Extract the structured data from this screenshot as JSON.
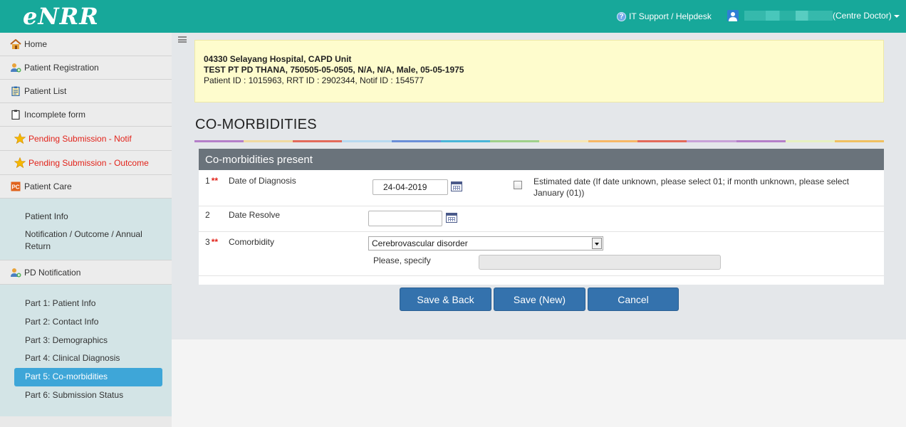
{
  "app": {
    "logo": "eNRR"
  },
  "header": {
    "helpdesk_label": "IT Support / Helpdesk",
    "user_role": "(Centre Doctor)"
  },
  "sidebar": {
    "items": [
      {
        "label": "Home",
        "icon": "home-icon"
      },
      {
        "label": "Patient Registration",
        "icon": "user-add-icon"
      },
      {
        "label": "Patient List",
        "icon": "clipboard-icon"
      },
      {
        "label": "Incomplete form",
        "icon": "clipboard-icon"
      },
      {
        "label": "Pending Submission - Notif",
        "icon": "star-icon"
      },
      {
        "label": "Pending Submission - Outcome",
        "icon": "star-icon"
      },
      {
        "label": "Patient Care",
        "icon": "pc-icon"
      }
    ],
    "patient_care_sub": [
      {
        "label": "Patient Info"
      },
      {
        "label": "Notification / Outcome / Annual Return"
      }
    ],
    "pd_notification": {
      "label": "PD Notification",
      "icon": "user-add-icon"
    },
    "pd_sub": [
      {
        "label": "Part 1: Patient Info"
      },
      {
        "label": "Part 2: Contact Info"
      },
      {
        "label": "Part 3: Demographics"
      },
      {
        "label": "Part 4: Clinical Diagnosis"
      },
      {
        "label": "Part 5: Co-morbidities",
        "active": true
      },
      {
        "label": "Part 6: Submission Status"
      }
    ]
  },
  "patient": {
    "centre": "04330 Selayang Hospital, CAPD Unit",
    "details": "TEST PT PD THANA, 750505-05-0505, N/A, N/A, Male, 05-05-1975",
    "ids": "Patient ID : 1015963, RRT ID : 2902344, Notif ID : 154577"
  },
  "page": {
    "title": "CO-MORBIDITIES"
  },
  "form": {
    "panel_title": "Co-morbidities present",
    "required_mark": "**",
    "fields": {
      "diagnosis": {
        "num": "1",
        "label": "Date of Diagnosis",
        "value": "24-04-2019",
        "estimated_label": "Estimated date (If date unknown, please select 01; if month unknown, please select January (01))",
        "estimated_checked": false
      },
      "resolve": {
        "num": "2",
        "label": "Date Resolve",
        "value": ""
      },
      "comorbidity": {
        "num": "3",
        "label": "Comorbidity",
        "value": "Cerebrovascular disorder",
        "specify_label": "Please, specify",
        "specify_value": ""
      }
    }
  },
  "buttons": {
    "save_back": "Save & Back",
    "save_new": "Save (New)",
    "cancel": "Cancel"
  },
  "colors": {
    "header": "#17a89a",
    "primary_button": "#3472ad",
    "required": "#e2231a",
    "active_nav": "#3ea6d8"
  }
}
